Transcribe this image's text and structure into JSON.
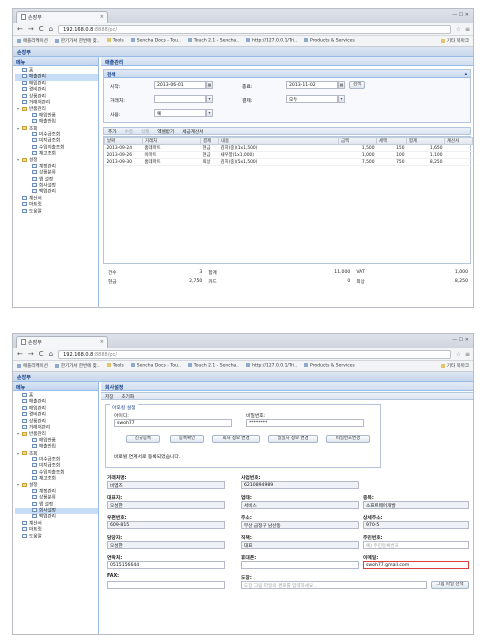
{
  "browser": {
    "tab_title": "손장부",
    "tab_close": "×",
    "win_ctrl": "— ☐ ✕",
    "back": "←",
    "forward": "→",
    "reload": "C",
    "home": "⌂",
    "url_host": "192.168.0.8",
    "url_rest": ":8888/pc/",
    "star": "☆",
    "menu": "≡",
    "bookmarks": [
      "애플리케이션",
      "한기가서 한번에 찾..",
      "Tools",
      "Sencha Docs - Tou..",
      "Touch 2.1 - Sencha..",
      "http://127.0.0.1/Tri..",
      "Products & Services"
    ],
    "other_bookmarks": "기타 북마크"
  },
  "app": {
    "title": "손장부",
    "sidebar_title": "메뉴",
    "tree": [
      {
        "label": "홈",
        "level": 1,
        "folder": false
      },
      {
        "label": "매출관리",
        "level": 1,
        "folder": false
      },
      {
        "label": "매입관리",
        "level": 1,
        "folder": false
      },
      {
        "label": "경비관리",
        "level": 1,
        "folder": false
      },
      {
        "label": "상품관리",
        "level": 1,
        "folder": false
      },
      {
        "label": "거래처관리",
        "level": 1,
        "folder": false
      },
      {
        "label": "반품관리",
        "level": 1,
        "folder": true
      },
      {
        "label": "매입반품",
        "level": 2,
        "folder": false
      },
      {
        "label": "매출반입",
        "level": 2,
        "folder": false
      },
      {
        "label": "조회",
        "level": 1,
        "folder": true
      },
      {
        "label": "미수금조회",
        "level": 2,
        "folder": false
      },
      {
        "label": "미지급조회",
        "level": 2,
        "folder": false
      },
      {
        "label": "수입지출조회",
        "level": 2,
        "folder": false
      },
      {
        "label": "재고조회",
        "level": 2,
        "folder": false
      },
      {
        "label": "설정",
        "level": 1,
        "folder": true
      },
      {
        "label": "계정관리",
        "level": 2,
        "folder": false
      },
      {
        "label": "상품분류",
        "level": 2,
        "folder": false
      },
      {
        "label": "앱 설정",
        "level": 2,
        "folder": false
      },
      {
        "label": "회사설정",
        "level": 2,
        "folder": false
      },
      {
        "label": "백업관리",
        "level": 2,
        "folder": false
      },
      {
        "label": "계산서",
        "level": 1,
        "folder": false
      },
      {
        "label": "마트릿",
        "level": 1,
        "folder": false
      },
      {
        "label": "도움말",
        "level": 1,
        "folder": false
      }
    ]
  },
  "sales": {
    "panel_title": "매출관리",
    "search_title": "검색",
    "collapse_glyph": "▴",
    "start_label": "시작:",
    "start_value": "2013-06-01",
    "end_label": "종료:",
    "end_value": "2013-11-02",
    "search_btn": "검색",
    "client_label": "거래처:",
    "client_value": "",
    "payment_label": "결제:",
    "payment_value": "모두",
    "use_label": "사용:",
    "use_value": "예",
    "calendar_glyph": "▦",
    "dropdown_glyph": "▾",
    "toolbar": [
      "추가",
      "수정",
      "삭제",
      "엑셀받기",
      "세금계산서"
    ],
    "columns": [
      "날짜",
      "거래처",
      "결제",
      "내용",
      "금액",
      "세액",
      "합계",
      "계산서"
    ],
    "rows": [
      [
        "2013-09-24",
        "홈데마트",
        "현금",
        "김치(중)(1x1,500)",
        "1,500",
        "150",
        "1,650",
        ""
      ],
      [
        "2013-09-26",
        "이마트",
        "현금",
        "새우깡(1x1,000)",
        "1,000",
        "100",
        "1,100",
        ""
      ],
      [
        "2013-09-30",
        "홈데마트",
        "외상",
        "김치(중)(5x1,500)",
        "7,500",
        "750",
        "8,250",
        ""
      ]
    ],
    "summary": {
      "count_label": "건수",
      "count_value": "3",
      "total_label": "합계",
      "total_value": "11,000",
      "vat_label": "VAT",
      "vat_value": "1,000",
      "cash_label": "현금",
      "cash_value": "2,750",
      "card_label": "카드",
      "card_value": "0",
      "credit_label": "외상",
      "credit_value": "8,250"
    }
  },
  "company": {
    "panel_title": "회사설정",
    "save_btn": "저장",
    "reset_btn": "초기화",
    "fieldset_title": "아포킬 설정",
    "id_label": "아이디:",
    "id_value": "swoh77",
    "pw_label": "비밀번호:",
    "pw_value": "********",
    "buttons": [
      "신규등록",
      "등록확인",
      "회사 정보 변경",
      "일일자 정보 변경",
      "비밀번호변경"
    ],
    "status_msg": "바로빌 연계서로 등록되었습니다.",
    "name_label": "거래처명:",
    "name_value": "비엠즈",
    "bizno_label": "사업번호:",
    "bizno_value": "6210894989",
    "ceo_label": "대표자:",
    "ceo_value": "오성한",
    "biztype_label": "업태:",
    "biztype_value": "서비스",
    "item_label": "종목:",
    "item_value": "소프트웨어개발",
    "zip_label": "우편번호:",
    "zip_value": "609-815",
    "addr_label": "주소:",
    "addr_value": "부산 금정구 남산동",
    "addr2_label": "상세주소:",
    "addr2_value": "970-5",
    "manager_label": "담당자:",
    "manager_value": "오성한",
    "position_label": "직책:",
    "position_value": "대표",
    "dept_label": "주민번호:",
    "dept_placeholder": "예) 주민등록번호",
    "phone_label": "연락처:",
    "phone_value": "0515156644",
    "mobile_label": "휴대폰:",
    "mobile_value": "",
    "email_label": "이메일:",
    "email_value": "swoh77.gmail.com",
    "fax_label": "FAX:",
    "fax_value": "",
    "stamp_label": "도장:",
    "stamp_placeholder": "도장 그림 파일의 경로를 입력하세요...",
    "stamp_btn": "그림 파일 선택"
  }
}
